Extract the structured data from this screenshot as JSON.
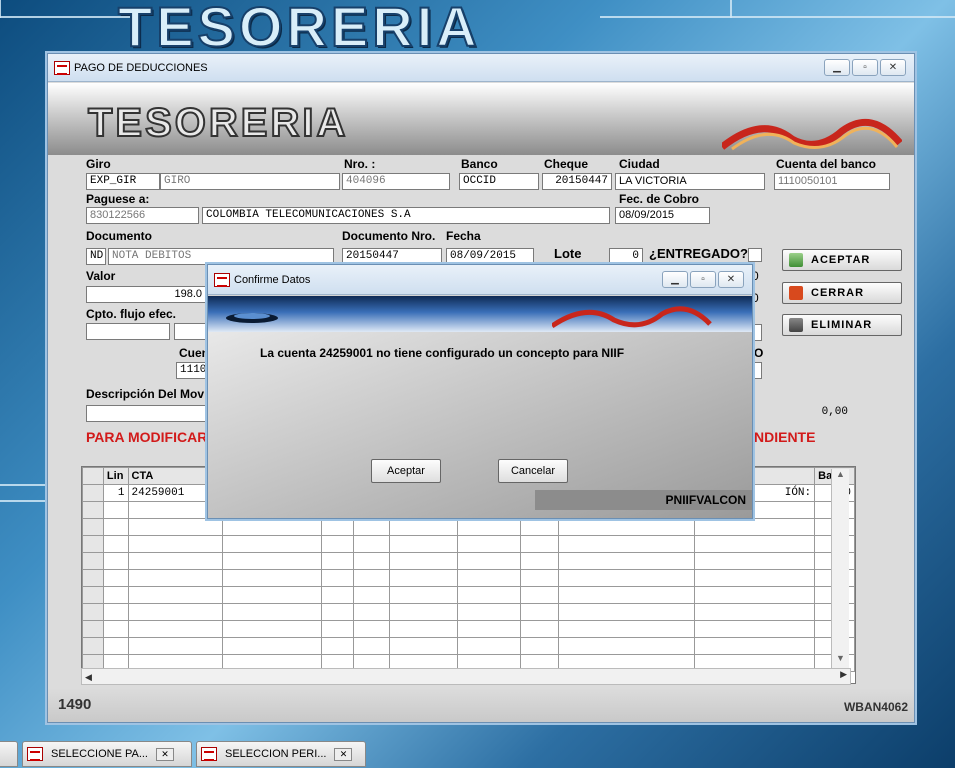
{
  "background": {
    "title": "TESORERIA"
  },
  "main": {
    "title": "PAGO DE DEDUCCIONES",
    "banner_title": "TESORERIA",
    "labels": {
      "giro": "Giro",
      "nro": "Nro. :",
      "banco": "Banco",
      "cheque": "Cheque",
      "ciudad": "Ciudad",
      "cuenta_banco": "Cuenta del banco",
      "paguese": "Paguese a:",
      "fec_cobro": "Fec. de Cobro",
      "documento": "Documento",
      "documento_nro": "Documento Nro.",
      "fecha": "Fecha",
      "lote": "Lote",
      "entregado": "¿ENTREGADO?",
      "valor": "Valor",
      "cpto_flujo": "Cpto. flujo efec.",
      "cuen_partial": "Cuen",
      "descripcion": "Descripción Del Mov",
      "para_modificar": "PARA MODIFICAR",
      "ndiente": "NDIENTE",
      "o_partial": "O"
    },
    "fields": {
      "giro_code": "EXP_GIR",
      "giro_name": "GIRO",
      "nro": "404096",
      "banco": "OCCID",
      "cheque": "20150447",
      "ciudad": "LA VICTORIA",
      "cuenta_banco": "1110050101",
      "paguese_nit": "830122566",
      "paguese_name": "COLOMBIA TELECOMUNICACIONES S.A",
      "fec_cobro": "08/09/2015",
      "doc_code": "ND",
      "doc_name": "NOTA DEBITOS",
      "doc_nro": "20150447",
      "fecha": "08/09/2015",
      "lote": "0",
      "valor": "198.0",
      "cuen_value": "1110",
      "right_total": "0,00",
      "side_0a": "0",
      "side_0b": "0"
    },
    "buttons": {
      "aceptar": "ACEPTAR",
      "cerrar": "CERRAR",
      "eliminar": "ELIMINAR"
    },
    "grid": {
      "headers": [
        "Lin",
        "CTA",
        "Base"
      ],
      "rows": [
        {
          "lin": "1",
          "cta": "24259001",
          "mid": "IÓN:",
          "base": "0"
        }
      ]
    },
    "status": {
      "left": "1490",
      "right": "WBAN4062"
    }
  },
  "dialog": {
    "title": "Confirme Datos",
    "message": "La cuenta 24259001 no tiene configurado un concepto para NIIF",
    "aceptar": "Aceptar",
    "cancelar": "Cancelar",
    "footer": "PNIIFVALCON"
  },
  "taskbar": [
    {
      "label": "SELECCIONE PA..."
    },
    {
      "label": "SELECCION PERI..."
    }
  ],
  "colors": {
    "accent_red": "#d21a1a",
    "title_blue": "#2d6fa3"
  }
}
